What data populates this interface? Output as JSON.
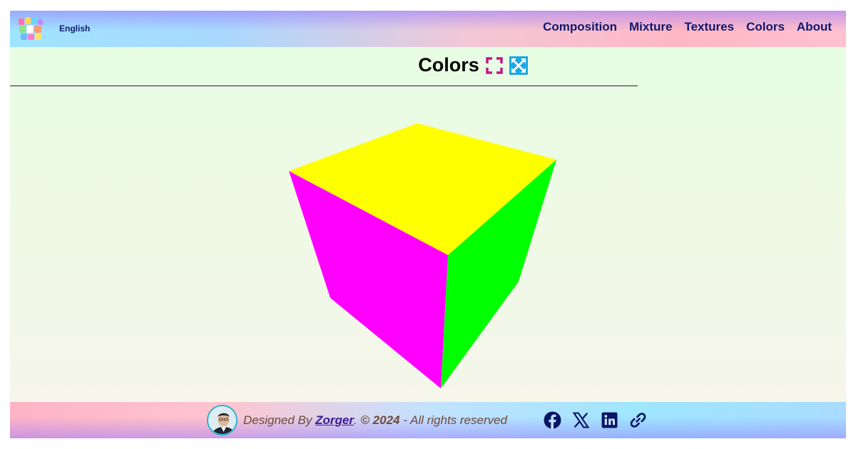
{
  "header": {
    "language": "English",
    "nav": [
      "Composition",
      "Mixture",
      "Textures",
      "Colors",
      "About"
    ]
  },
  "main": {
    "title": "Colors",
    "cube_faces": {
      "top": "#ffff00",
      "left": "#ff00ff",
      "right": "#00ff00"
    }
  },
  "footer": {
    "prefix": "Designed By ",
    "author": "Zorger",
    "dot": ". ",
    "copyright": "© 2024",
    "suffix": " - All rights reserved",
    "social_icons": [
      "facebook-icon",
      "x-icon",
      "linkedin-icon",
      "link-icon"
    ]
  },
  "colors": {
    "nav_text": "#0e1a72",
    "accent_pink": "#c2168a",
    "accent_blue": "#1ba8e6"
  }
}
